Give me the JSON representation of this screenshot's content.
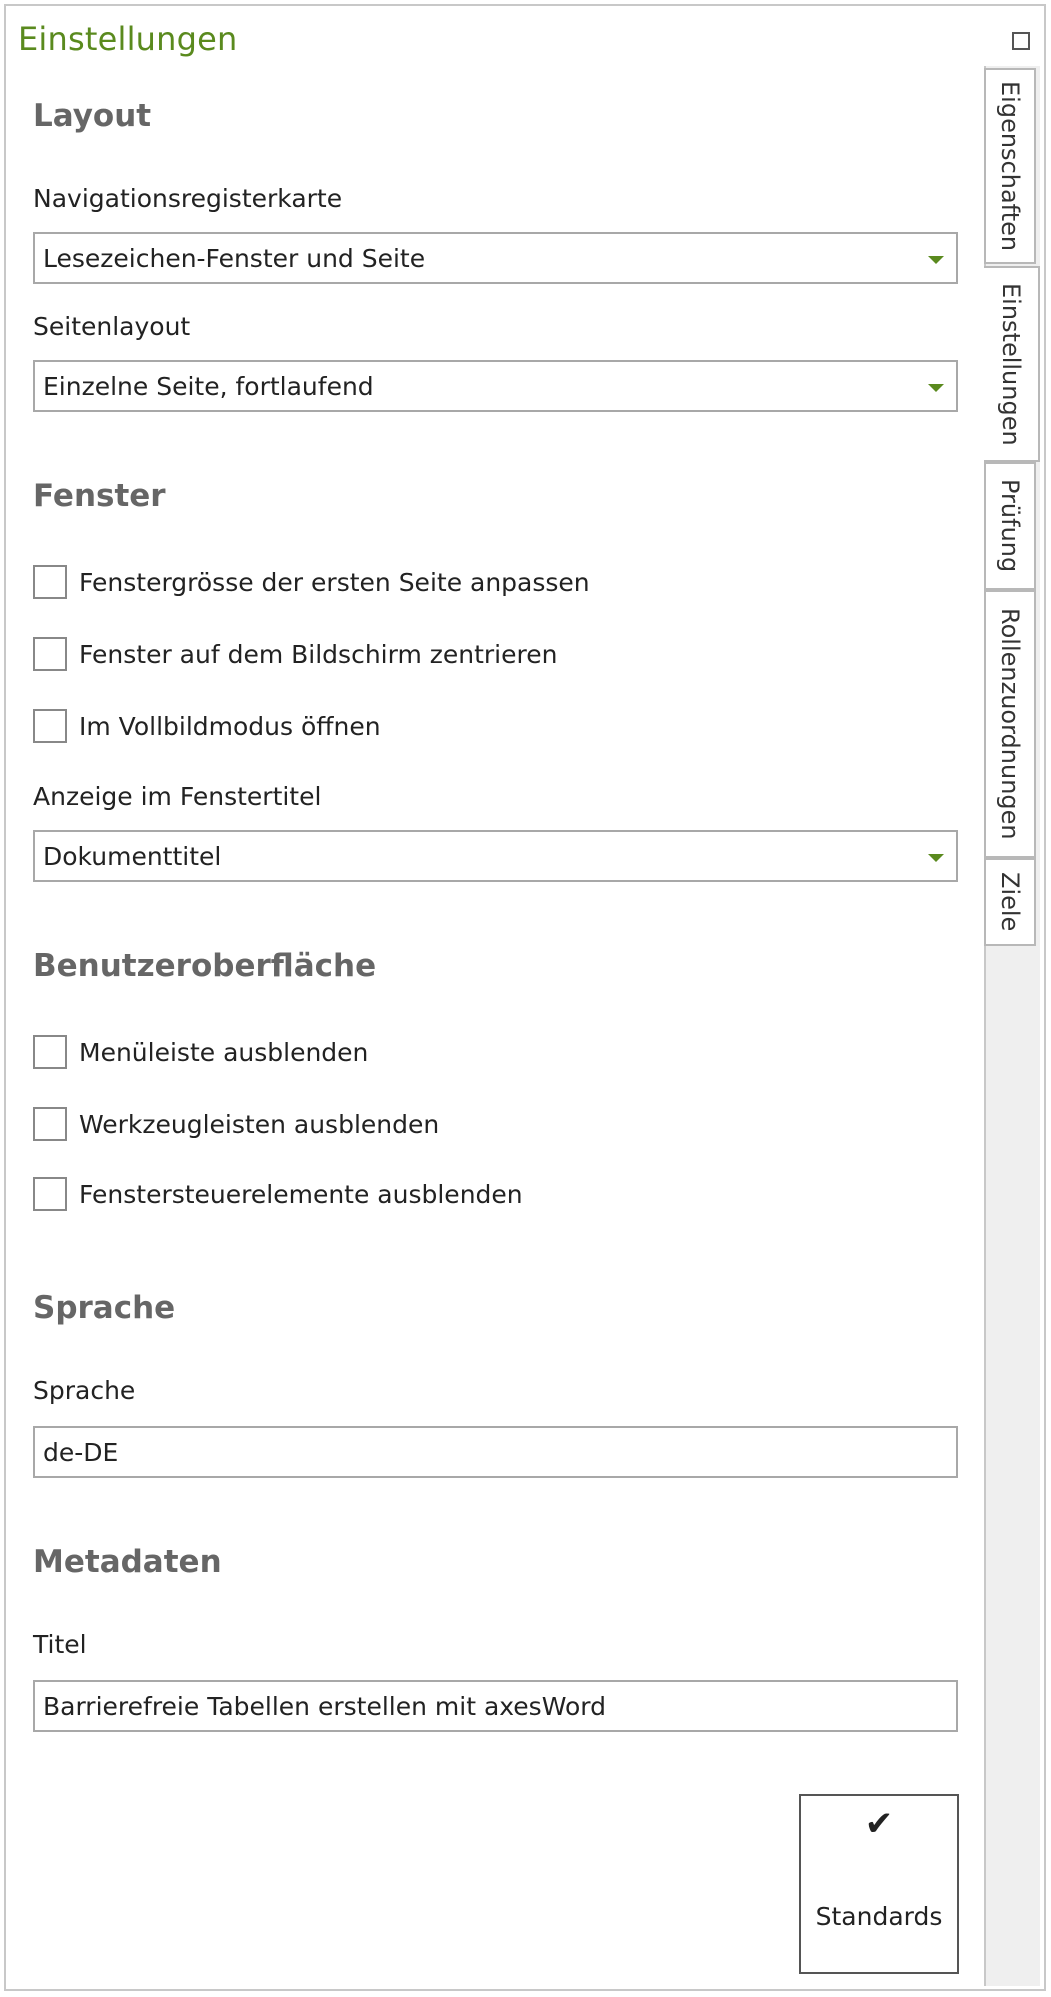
{
  "panel": {
    "title": "Einstellungen"
  },
  "tabs": [
    {
      "label": "Eigenschaften",
      "active": false
    },
    {
      "label": "Einstellungen",
      "active": true
    },
    {
      "label": "Prüfung",
      "active": false
    },
    {
      "label": "Rollenzuordnungen",
      "active": false
    },
    {
      "label": "Ziele",
      "active": false
    }
  ],
  "layout": {
    "heading": "Layout",
    "nav_tab_label": "Navigationsregisterkarte",
    "nav_tab_value": "Lesezeichen-Fenster und Seite",
    "page_layout_label": "Seitenlayout",
    "page_layout_value": "Einzelne Seite, fortlaufend"
  },
  "window": {
    "heading": "Fenster",
    "checkboxes": [
      {
        "label": "Fenstergrösse der ersten Seite anpassen",
        "checked": false
      },
      {
        "label": "Fenster auf dem Bildschirm zentrieren",
        "checked": false
      },
      {
        "label": "Im Vollbildmodus öffnen",
        "checked": false
      }
    ],
    "title_display_label": "Anzeige im Fenstertitel",
    "title_display_value": "Dokumenttitel"
  },
  "ui": {
    "heading": "Benutzeroberfläche",
    "checkboxes": [
      {
        "label": "Menüleiste ausblenden",
        "checked": false
      },
      {
        "label": "Werkzeugleisten ausblenden",
        "checked": false
      },
      {
        "label": "Fenstersteuerelemente ausblenden",
        "checked": false
      }
    ]
  },
  "language": {
    "heading": "Sprache",
    "field_label": "Sprache",
    "value": "de-DE"
  },
  "metadata": {
    "heading": "Metadaten",
    "title_label": "Titel",
    "title_value": "Barrierefreie Tabellen erstellen mit axesWord"
  },
  "defaults_button": {
    "icon": "checkmark-icon",
    "label": "Standards"
  },
  "colors": {
    "accent": "#5a8a1e",
    "heading": "#666666",
    "border": "#a8a8a8"
  }
}
